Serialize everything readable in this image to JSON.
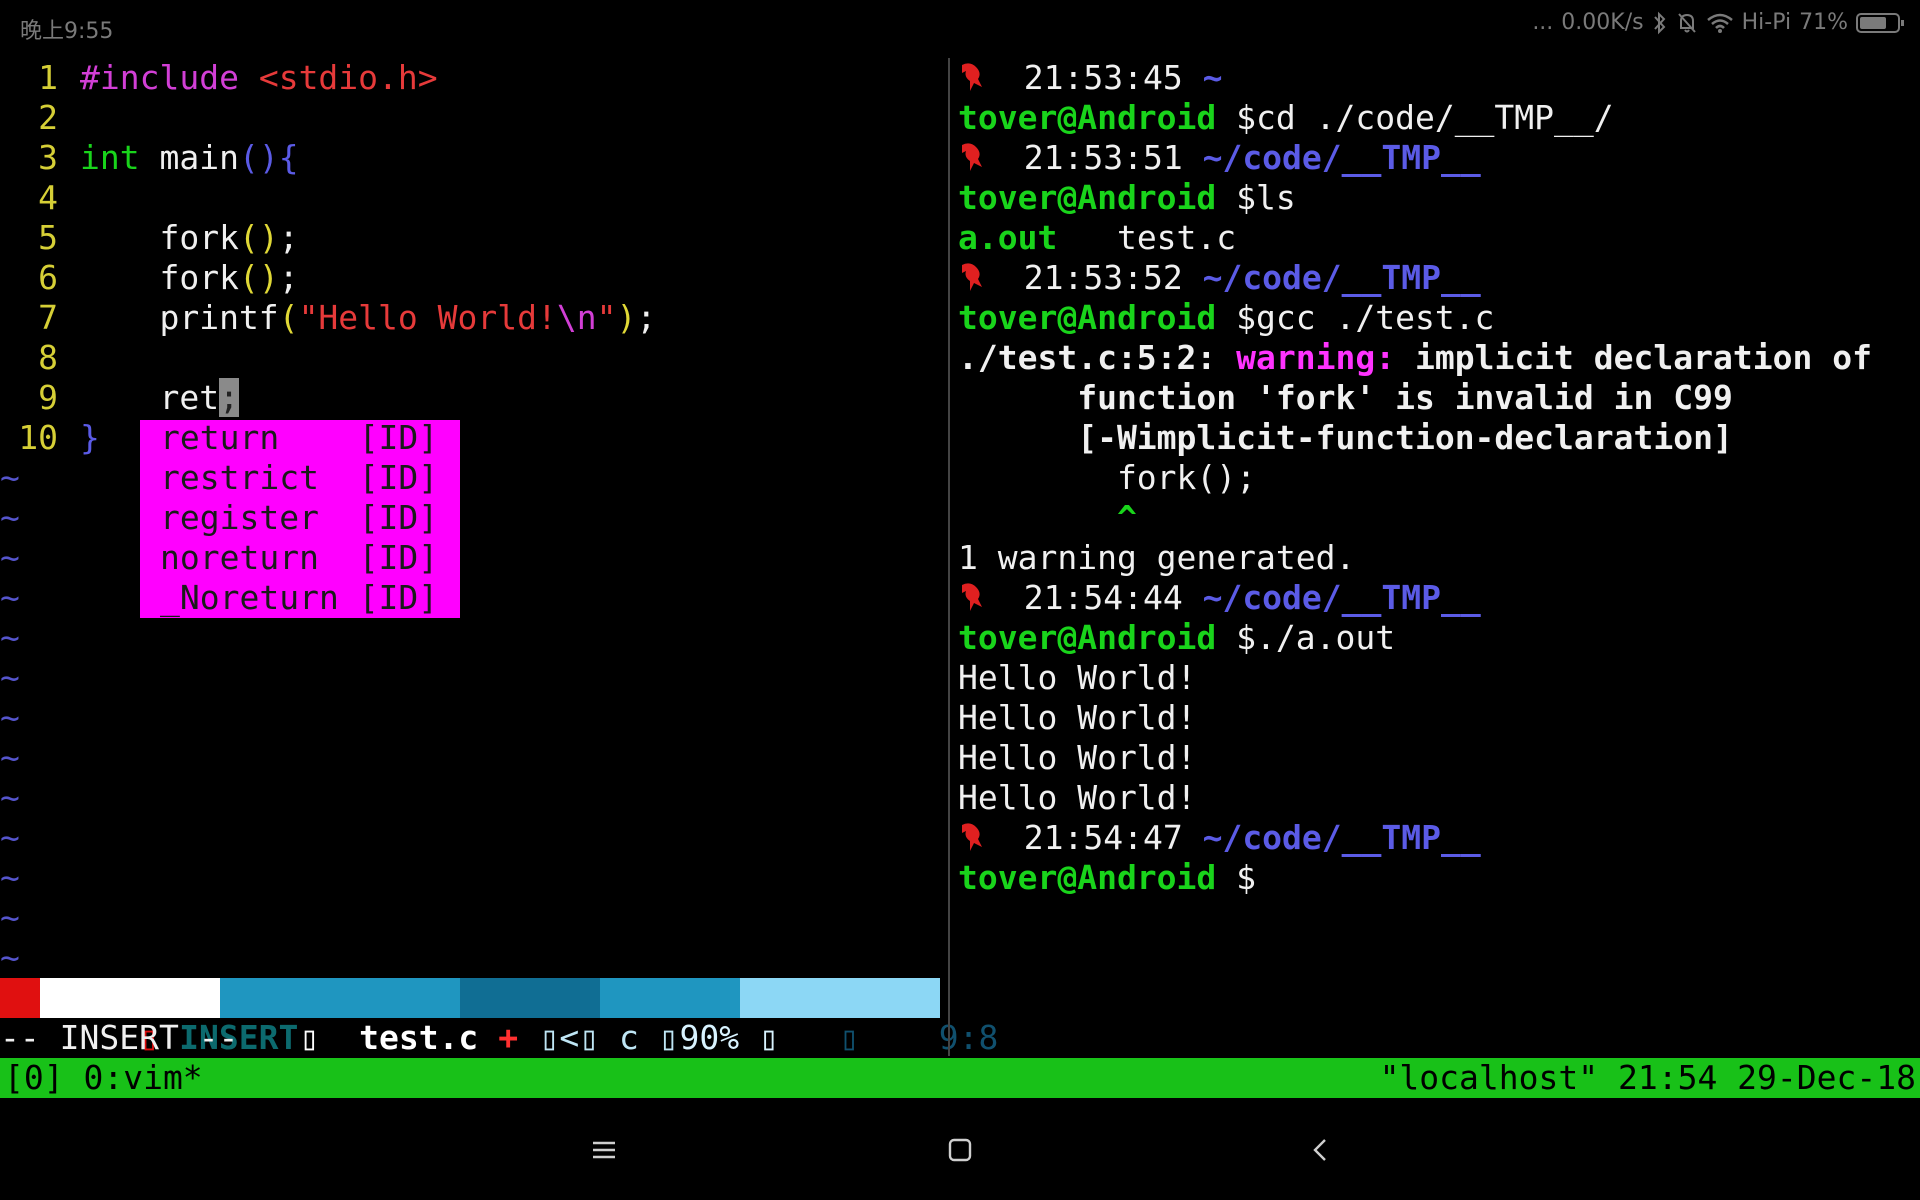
{
  "status_bar": {
    "time": "晚上9:55",
    "dots": "...",
    "net_speed": "0.00K/s",
    "network_name": "Hi-Pi",
    "battery_percent": "71%",
    "battery_level": 0.71,
    "icons": [
      "bluetooth-icon",
      "mute-bell-icon",
      "wifi-icon",
      "battery-icon"
    ]
  },
  "vim": {
    "lines": [
      {
        "n": "1",
        "parts": [
          {
            "t": "#include",
            "c": "magenta"
          },
          {
            "t": " ",
            "c": "white"
          },
          {
            "t": "<stdio.h>",
            "c": "red"
          }
        ]
      },
      {
        "n": "2",
        "parts": []
      },
      {
        "n": "3",
        "parts": [
          {
            "t": "int",
            "c": "green"
          },
          {
            "t": " main",
            "c": "white"
          },
          {
            "t": "()",
            "c": "blue"
          },
          {
            "t": "{",
            "c": "blue"
          }
        ]
      },
      {
        "n": "4",
        "parts": []
      },
      {
        "n": "5",
        "parts": [
          {
            "t": "    fork",
            "c": "white"
          },
          {
            "t": "()",
            "c": "paren"
          },
          {
            "t": ";",
            "c": "white"
          }
        ]
      },
      {
        "n": "6",
        "parts": [
          {
            "t": "    fork",
            "c": "white"
          },
          {
            "t": "()",
            "c": "paren"
          },
          {
            "t": ";",
            "c": "white"
          }
        ]
      },
      {
        "n": "7",
        "parts": [
          {
            "t": "    printf",
            "c": "white"
          },
          {
            "t": "(",
            "c": "paren"
          },
          {
            "t": "\"Hello World!",
            "c": "red"
          },
          {
            "t": "\\n",
            "c": "magenta"
          },
          {
            "t": "\"",
            "c": "red"
          },
          {
            "t": ")",
            "c": "paren"
          },
          {
            "t": ";",
            "c": "white"
          }
        ]
      },
      {
        "n": "8",
        "parts": []
      },
      {
        "n": "9",
        "parts": [
          {
            "t": "    ret",
            "c": "white"
          },
          {
            "t": ";",
            "c": "cursor"
          }
        ]
      },
      {
        "n": "10",
        "parts": [
          {
            "t": "}",
            "c": "blue"
          }
        ]
      }
    ],
    "tilde": "~",
    "tilde_count": 13,
    "completion": [
      {
        "word": "return",
        "kind": "[ID]"
      },
      {
        "word": "restrict",
        "kind": "[ID]"
      },
      {
        "word": "register",
        "kind": "[ID]"
      },
      {
        "word": "noreturn",
        "kind": "[ID]"
      },
      {
        "word": "_Noreturn",
        "kind": "[ID]"
      }
    ],
    "statusline": {
      "mode": "INSERT",
      "file": "test.c",
      "modified": "+",
      "arrow": "<",
      "filetype": "c",
      "percent": "90%",
      "position": "9:8"
    },
    "mode_line": "-- INSERT --"
  },
  "shell": {
    "lines": [
      {
        "kind": "prompt",
        "time": "21:53:45",
        "path": "~"
      },
      {
        "kind": "cmd",
        "user": "tover@Android",
        "cmd": " $cd ./code/__TMP__/"
      },
      {
        "kind": "prompt",
        "time": "21:53:51",
        "path": "~/code/__TMP__"
      },
      {
        "kind": "cmd",
        "user": "tover@Android",
        "cmd": " $ls"
      },
      {
        "kind": "ls",
        "a": "a.out",
        "b": "   test.c"
      },
      {
        "kind": "prompt",
        "time": "21:53:52",
        "path": "~/code/__TMP__"
      },
      {
        "kind": "cmd",
        "user": "tover@Android",
        "cmd": " $gcc ./test.c"
      },
      {
        "kind": "warn",
        "loc": "./test.c:5:2: ",
        "label": "warning:",
        "msg": " implicit declaration of"
      },
      {
        "kind": "text",
        "t": "      function 'fork' is invalid in C99",
        "bold": true
      },
      {
        "kind": "text",
        "t": "      [-Wimplicit-function-declaration]",
        "bold": true
      },
      {
        "kind": "text",
        "t": "        fork();",
        "bold": false
      },
      {
        "kind": "caret",
        "t": "        ^"
      },
      {
        "kind": "text",
        "t": "1 warning generated.",
        "bold": false
      },
      {
        "kind": "prompt",
        "time": "21:54:44",
        "path": "~/code/__TMP__"
      },
      {
        "kind": "cmd",
        "user": "tover@Android",
        "cmd": " $./a.out"
      },
      {
        "kind": "text",
        "t": "Hello World!",
        "bold": false
      },
      {
        "kind": "text",
        "t": "Hello World!",
        "bold": false
      },
      {
        "kind": "text",
        "t": "Hello World!",
        "bold": false
      },
      {
        "kind": "text",
        "t": "Hello World!",
        "bold": false
      },
      {
        "kind": "prompt",
        "time": "21:54:47",
        "path": "~/code/__TMP__"
      },
      {
        "kind": "cmd",
        "user": "tover@Android",
        "cmd": " $"
      }
    ]
  },
  "tmux": {
    "left": "[0] 0:vim*",
    "right": "\"localhost\" 21:54 29-Dec-18"
  },
  "navbar": {
    "buttons": [
      {
        "name": "menu-icon",
        "glyph": "☰"
      },
      {
        "name": "home-icon",
        "glyph": "▢"
      },
      {
        "name": "back-icon",
        "glyph": "‹"
      }
    ]
  },
  "colors": {
    "tmux_bar": "#18c118",
    "popup": "#ff00ff",
    "insert_red": "#e01010",
    "file_blue": "#1f96c0",
    "pos_light_blue": "#8cd7f5"
  }
}
